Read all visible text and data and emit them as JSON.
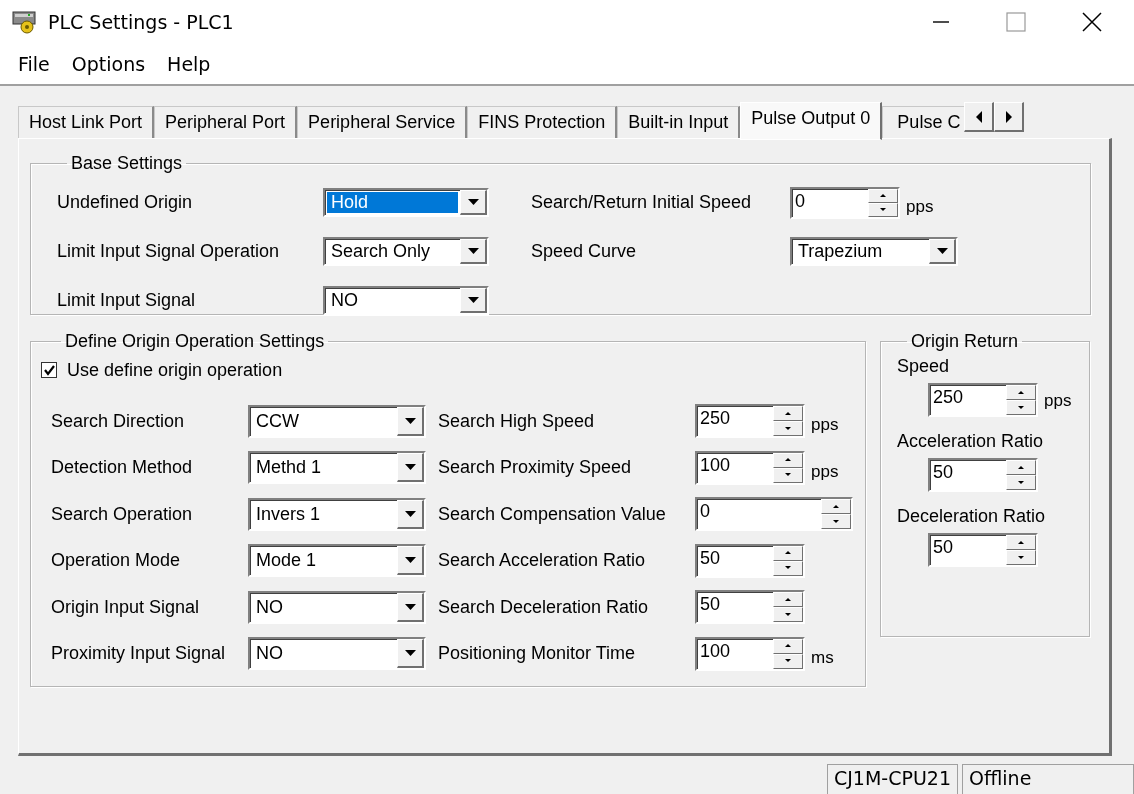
{
  "window": {
    "title": "PLC Settings - PLC1"
  },
  "menu": [
    "File",
    "Options",
    "Help"
  ],
  "tabs": [
    {
      "label": "Host Link Port",
      "selected": false
    },
    {
      "label": "Peripheral Port",
      "selected": false
    },
    {
      "label": "Peripheral Service",
      "selected": false
    },
    {
      "label": "FINS Protection",
      "selected": false
    },
    {
      "label": "Built-in Input",
      "selected": false
    },
    {
      "label": "Pulse Output 0",
      "selected": true
    },
    {
      "label": "Pulse C",
      "selected": false
    }
  ],
  "base_settings": {
    "title": "Base Settings",
    "left": [
      {
        "label": "Undefined Origin",
        "kind": "combo",
        "value": "Hold",
        "highlighted": true
      },
      {
        "label": "Limit Input Signal Operation",
        "kind": "combo",
        "value": "Search Only",
        "highlighted": false
      },
      {
        "label": "Limit Input Signal",
        "kind": "combo",
        "value": "NO",
        "highlighted": false
      }
    ],
    "right": [
      {
        "label": "Search/Return Initial Speed",
        "kind": "spin",
        "value": "0",
        "unit": "pps"
      },
      {
        "label": "Speed Curve",
        "kind": "combo",
        "value": "Trapezium",
        "highlighted": false
      }
    ]
  },
  "define_origin": {
    "title": "Define Origin Operation Settings",
    "checkbox": {
      "label": "Use define origin operation",
      "checked": true
    },
    "left": [
      {
        "label": "Search Direction",
        "value": "CCW"
      },
      {
        "label": "Detection Method",
        "value": "Methd 1"
      },
      {
        "label": "Search Operation",
        "value": "Invers 1"
      },
      {
        "label": "Operation Mode",
        "value": "Mode 1"
      },
      {
        "label": "Origin Input Signal",
        "value": "NO"
      },
      {
        "label": "Proximity Input Signal",
        "value": "NO"
      }
    ],
    "right": [
      {
        "label": "Search High Speed",
        "value": "250",
        "unit": "pps",
        "kind": "spin"
      },
      {
        "label": "Search Proximity Speed",
        "value": "100",
        "unit": "pps",
        "kind": "spin"
      },
      {
        "label": "Search Compensation Value",
        "value": "0",
        "kind": "wide-spin"
      },
      {
        "label": "Search Acceleration Ratio",
        "value": "50",
        "kind": "spin"
      },
      {
        "label": "Search Deceleration Ratio",
        "value": "50",
        "kind": "spin"
      },
      {
        "label": "Positioning Monitor Time",
        "value": "100",
        "unit": "ms",
        "kind": "spin"
      }
    ]
  },
  "origin_return": {
    "title": "Origin Return",
    "fields": [
      {
        "label": "Speed",
        "value": "250",
        "unit": "pps"
      },
      {
        "label": "Acceleration Ratio",
        "value": "50"
      },
      {
        "label": "Deceleration Ratio",
        "value": "50"
      }
    ]
  },
  "status_bar": [
    "CJ1M-CPU21",
    "Offline"
  ]
}
